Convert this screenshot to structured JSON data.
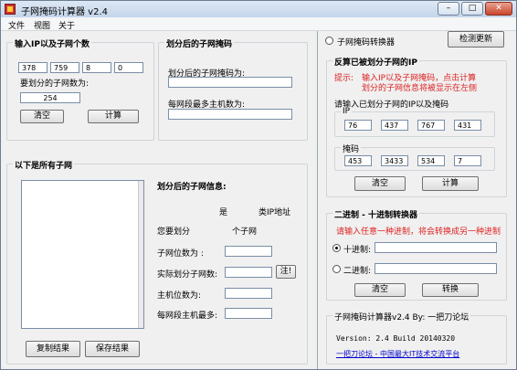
{
  "window": {
    "title": "子网掩码计算器 v2.4",
    "min_glyph": "–",
    "max_glyph": "□",
    "close_glyph": "✕"
  },
  "menu": [
    "文件",
    "视图",
    "关于"
  ],
  "input_group": {
    "title": "输入IP以及子网个数",
    "ip": [
      "378",
      "759",
      "8",
      "0"
    ],
    "subnet_count_label": "要划分的子网数为:",
    "subnet_count": "254",
    "clear": "清空",
    "calc": "计算"
  },
  "mask_group": {
    "title": "划分后的子网掩码",
    "mask_label": "划分后的子网掩码为:",
    "mask_value": "",
    "hosts_label": "每网段最多主机数为:",
    "hosts_value": ""
  },
  "subnets_group": {
    "title": "以下是所有子网",
    "info_title": "划分后的子网信息:",
    "is_label": "是",
    "class_label": "类IP地址",
    "you_want": "您要划分",
    "subnet_unit": "个子网",
    "subnet_bits_label": "子网位数为 :",
    "actual_label": "实际划分子网数:",
    "note_btn": "注!",
    "host_bits_label": "主机位数为:",
    "max_hosts_label": "每网段主机最多:",
    "copy_btn": "复制结果",
    "save_btn": "保存结果"
  },
  "converter_top": {
    "radio_label": "子网掩码转换器",
    "detect_btn": "检测更新"
  },
  "reverse_group": {
    "title": "反算已被划分子网的IP",
    "hint_prefix": "提示:",
    "hint_line1": "输入IP以及子网掩码，点击计算",
    "hint_line2": "划分的子网信息将被显示在左侧",
    "inner_title": "请输入已划分子网的IP以及掩码",
    "ip_label": "IP",
    "ip": [
      "76",
      "437",
      "767",
      "431"
    ],
    "mask_label": "掩码",
    "mask": [
      "453",
      "3433",
      "534",
      "7"
    ],
    "clear": "清空",
    "calc": "计算"
  },
  "binconv_group": {
    "title": "二进制 - 十进制转换器",
    "hint": "请输入任意一种进制，将会转换成另一种进制",
    "dec_label": "十进制:",
    "bin_label": "二进制:",
    "dec_value": "",
    "bin_value": "",
    "clear": "清空",
    "convert": "转换"
  },
  "about_group": {
    "title": "子网掩码计算器v2.4  By: 一把刀论坛",
    "version": "Version: 2.4    Build 20140320",
    "link": "一把刀论坛 - 中国最大IT技术交流平台"
  }
}
